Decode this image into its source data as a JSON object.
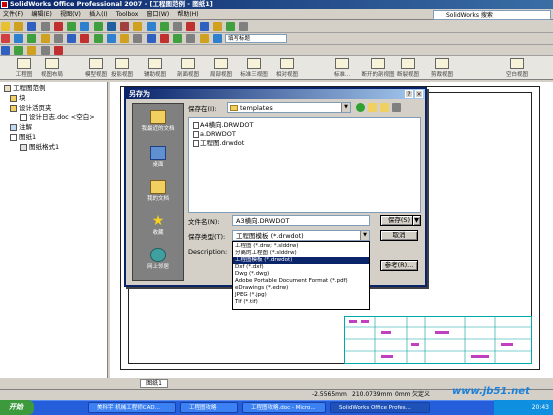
{
  "app": {
    "title": "SolidWorks Office Professional 2007 - [工程图范例 - 图纸1]",
    "menu": [
      "文件(F)",
      "编辑(E)",
      "视图(V)",
      "插入(I)",
      "Toolbox",
      "窗口(W)",
      "帮助(H)"
    ],
    "search_placeholder": "SolidWorks 搜索",
    "style_select": "填写标题"
  },
  "command_manager": {
    "items": [
      "工程图",
      "视图布局",
      "模型视图",
      "投影视图",
      "辅助视图",
      "剖面视图",
      "局部视图",
      "标准三视图",
      "相对视图",
      "标准...",
      "断开的剖视图",
      "断裂视图",
      "剪裁视图",
      "空白视图"
    ]
  },
  "feature_tree": {
    "items": [
      "工程图范例",
      "块",
      "设计活页夹",
      "设计日志.doc <空白>",
      "注解",
      "图纸1",
      "图纸格式1"
    ]
  },
  "dialog": {
    "title": "另存为",
    "look_in_label": "保存在(I):",
    "look_in_value": "templates",
    "places": [
      "我最近的文档",
      "桌面",
      "我的文档",
      "收藏",
      "网上邻居"
    ],
    "files": [
      "A4横向.DRWDOT",
      "a.DRWDOT",
      "工程图.drwdot"
    ],
    "filename_label": "文件名(N):",
    "filename_value": "A3横向.DRWDOT",
    "filetype_label": "保存类型(T):",
    "filetype_value": "工程图模板 (*.drwdot)",
    "description_label": "Description:",
    "save_button": "保存(S)",
    "cancel_button": "取消",
    "references_button": "参考(R)...",
    "type_options": [
      "工程图 (*.drw; *.slddrw)",
      "分离的工程图 (*.slddrw)",
      "工程图模板 (*.drwdot)",
      "Dxf (*.dxf)",
      "Dwg (*.dwg)",
      "Adobe Portable Document Format (*.pdf)",
      "eDrawings (*.edrw)",
      "JPEG (*.jpg)",
      "Tif (*.tif)"
    ],
    "selected_type_index": 2
  },
  "sheet_tab": "图纸1",
  "statusbar": {
    "x": "-2.5565mm",
    "y": "210.0739mm",
    "z": "0mm",
    "state": "欠定义"
  },
  "taskbar": {
    "start": "开始",
    "tasks": [
      "美科宇 机械工程师CAD...",
      "工程图攻略",
      "工程图攻略.doc - Micro...",
      "SolidWorks Office Profes..."
    ],
    "clock": "20:43"
  },
  "watermark": "www.jb51.net",
  "colors": {
    "titlebar": "#0a246a",
    "dialog_bg": "#d4d0c8",
    "taskbar": "#245edb",
    "selection": "#0a246a"
  }
}
